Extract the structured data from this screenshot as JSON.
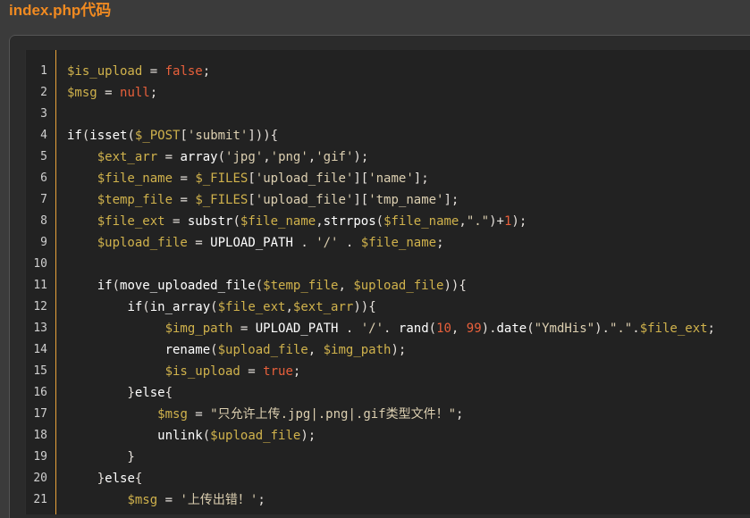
{
  "page": {
    "title": "index.php代码"
  },
  "code": {
    "lines": [
      {
        "n": "1",
        "text": "$is_upload = false;"
      },
      {
        "n": "2",
        "text": "$msg = null;"
      },
      {
        "n": "3",
        "text": ""
      },
      {
        "n": "4",
        "text": "if(isset($_POST['submit'])){"
      },
      {
        "n": "5",
        "text": "    $ext_arr = array('jpg','png','gif');"
      },
      {
        "n": "6",
        "text": "    $file_name = $_FILES['upload_file']['name'];"
      },
      {
        "n": "7",
        "text": "    $temp_file = $_FILES['upload_file']['tmp_name'];"
      },
      {
        "n": "8",
        "text": "    $file_ext = substr($file_name,strrpos($file_name,\".\")+1);"
      },
      {
        "n": "9",
        "text": "    $upload_file = UPLOAD_PATH . '/' . $file_name;"
      },
      {
        "n": "10",
        "text": ""
      },
      {
        "n": "11",
        "text": "    if(move_uploaded_file($temp_file, $upload_file)){"
      },
      {
        "n": "12",
        "text": "        if(in_array($file_ext,$ext_arr)){"
      },
      {
        "n": "13",
        "text": "             $img_path = UPLOAD_PATH . '/'. rand(10, 99).date(\"YmdHis\").\".\".$file_ext;"
      },
      {
        "n": "14",
        "text": "             rename($upload_file, $img_path);"
      },
      {
        "n": "15",
        "text": "             $is_upload = true;"
      },
      {
        "n": "16",
        "text": "        }else{"
      },
      {
        "n": "17",
        "text": "            $msg = \"只允许上传.jpg|.png|.gif类型文件！\";"
      },
      {
        "n": "18",
        "text": "            unlink($upload_file);"
      },
      {
        "n": "19",
        "text": "        }"
      },
      {
        "n": "20",
        "text": "    }else{"
      },
      {
        "n": "21",
        "text": "        $msg = '上传出错！';"
      }
    ]
  }
}
